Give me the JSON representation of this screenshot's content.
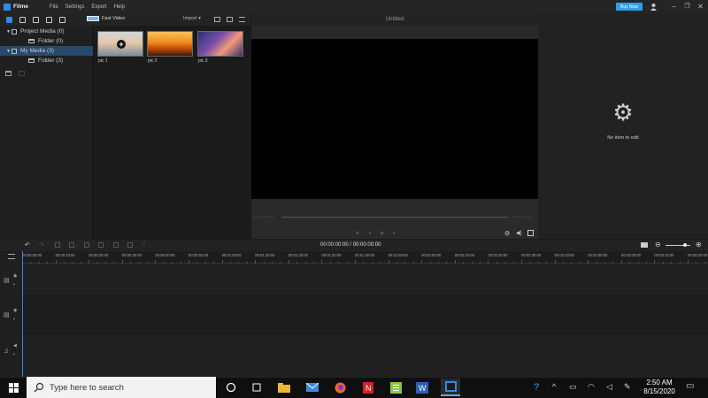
{
  "app": {
    "name": "Filme",
    "menu": [
      "File",
      "Settings",
      "Export",
      "Help"
    ],
    "buy_label": "Buy Now"
  },
  "media": {
    "fast_video_label": "Fast Video",
    "import_label": "Import",
    "tree": [
      {
        "label": "Project Media (0)",
        "expanded": true,
        "selected": false
      },
      {
        "label": "Folder (0)",
        "expanded": null,
        "selected": false
      },
      {
        "label": "My Media (3)",
        "expanded": true,
        "selected": true
      },
      {
        "label": "Folder (3)",
        "expanded": null,
        "selected": false
      }
    ],
    "items": [
      {
        "label": "pic 1",
        "colors": [
          "#d7cfc6",
          "#7d8fa3"
        ]
      },
      {
        "label": "pic 2",
        "colors": [
          "#f0a129",
          "#8a2a08"
        ]
      },
      {
        "label": "pic 3",
        "colors": [
          "#3b2a6f",
          "#f08a6a"
        ]
      }
    ]
  },
  "preview": {
    "title": "Untitled",
    "time_left": "00:00:00:00",
    "time_right": "00:00:00:00"
  },
  "properties": {
    "empty_text": "No item to edit"
  },
  "timeline": {
    "timecode": "00:00:00:00  /  00:00:00:00",
    "ruler": [
      "00:00:00:00",
      "00:00:10:00",
      "00:00:20:00",
      "00:00:30:00",
      "00:00:40:00",
      "00:00:50:00",
      "00:01:00:00",
      "00:01:10:00",
      "00:01:20:00",
      "00:01:30:00",
      "00:01:40:00",
      "00:01:50:00",
      "00:02:00:00",
      "00:02:10:00",
      "00:02:20:00",
      "00:02:30:00",
      "00:02:40:00",
      "00:02:50:00",
      "00:03:00:00",
      "00:03:10:00",
      "00:03:20:00"
    ]
  },
  "taskbar": {
    "search_placeholder": "Type here to search",
    "time": "2:50 AM",
    "date": "8/15/2020",
    "accent": "#2d8ceb"
  }
}
